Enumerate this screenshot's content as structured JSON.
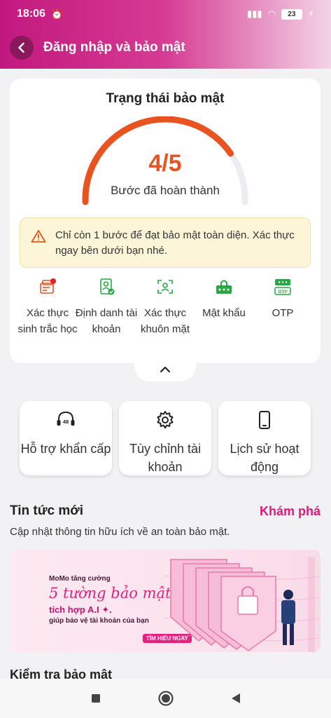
{
  "status_bar": {
    "time": "18:06",
    "battery": "23"
  },
  "header": {
    "title": "Đăng nhập và bảo mật"
  },
  "security": {
    "title": "Trạng thái bảo mật",
    "progress_text": "4/5",
    "progress_fraction": 0.8,
    "caption": "Bước đã hoàn thành",
    "warning": "Chỉ còn 1 bước để đạt bảo mật toàn diện. Xác thực ngay bên dưới bạn nhé.",
    "steps": [
      {
        "label": "Xác thực sinh trắc học",
        "icon": "biometric-card-icon",
        "color": "#e8531f",
        "done": false
      },
      {
        "label": "Định danh tài khoản",
        "icon": "id-card-check-icon",
        "color": "#27a844",
        "done": true
      },
      {
        "label": "Xác thực khuôn mặt",
        "icon": "face-scan-icon",
        "color": "#27a844",
        "done": true
      },
      {
        "label": "Mật khẩu",
        "icon": "password-lock-icon",
        "color": "#27a844",
        "done": true
      },
      {
        "label": "OTP",
        "icon": "otp-icon",
        "color": "#27a844",
        "done": true,
        "badge": "OTP"
      }
    ]
  },
  "tiles": [
    {
      "label": "Hỗ trợ khẩn cấp",
      "icon": "headset-48-icon",
      "badge": "48"
    },
    {
      "label": "Tùy chỉnh tài khoản",
      "icon": "gear-icon"
    },
    {
      "label": "Lịch sử hoạt động",
      "icon": "phone-icon"
    }
  ],
  "news": {
    "title": "Tin tức mới",
    "link": "Khám phá",
    "subtitle": "Cập nhật thông tin hữu ích về an toàn bảo mật.",
    "banner": {
      "line1": "MoMo tăng cường",
      "line2": "5 tường bảo mật",
      "line3": "tích hợp A.I ✦.",
      "line4": "giúp bảo vệ tài khoản của bạn",
      "cta": "TÌM HIỂU NGAY"
    }
  },
  "security_check": {
    "title": "Kiểm tra bảo mật"
  },
  "colors": {
    "brand": "#d81b7a",
    "gauge_active": "#e8531f",
    "gauge_track": "#ececf1",
    "warning_bg": "#fdf5d7",
    "success": "#27a844"
  }
}
